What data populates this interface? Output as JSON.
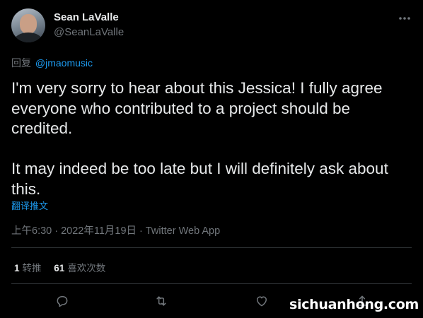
{
  "author": {
    "display_name": "Sean LaValle",
    "handle": "@SeanLaValle"
  },
  "reply": {
    "prefix": "回复",
    "mention": "@jmaomusic"
  },
  "tweet": {
    "text": "I'm very sorry to hear about this Jessica! I fully agree everyone who contributed to a project should be credited.\n\nIt may indeed be too late but I will definitely ask about this.",
    "translate_label": "翻译推文"
  },
  "meta": {
    "time": "上午6:30",
    "date": "2022年11月19日",
    "source": "Twitter Web App",
    "separator": "·"
  },
  "stats": {
    "retweets_count": "1",
    "retweets_label": "转推",
    "likes_count": "61",
    "likes_label": "喜欢次数"
  },
  "icons": {
    "more": "more-icon",
    "reply": "reply-icon",
    "retweet": "retweet-icon",
    "like": "heart-icon",
    "share": "share-icon"
  },
  "watermark": "sichuanhong.com",
  "colors": {
    "background": "#000000",
    "text": "#e7e9ea",
    "muted": "#71767b",
    "accent": "#1d9bf0",
    "divider": "#2f3336"
  }
}
